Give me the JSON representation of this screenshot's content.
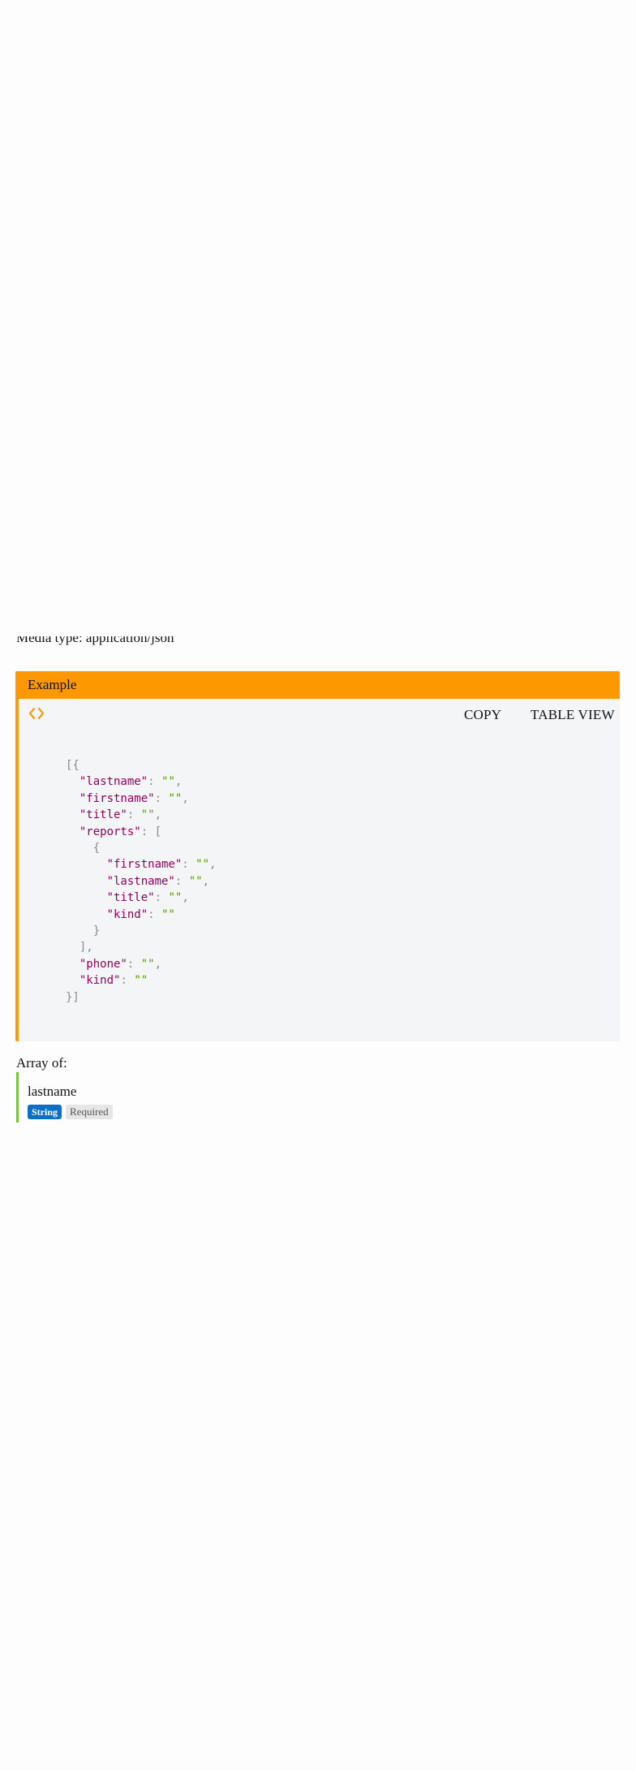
{
  "media_type": {
    "text": "Media type:  application/json"
  },
  "example": {
    "header": "Example",
    "toggle_icon": "code-brackets-icon",
    "copy_label": "COPY",
    "table_view_label": "TABLE VIEW",
    "accent_color": "#fd9801"
  },
  "schema": {
    "array_label": "Array of:",
    "property": {
      "name": "lastname",
      "type_badge": "String",
      "required_badge": "Required"
    },
    "type_color": "#0b6fc4",
    "property_border_color": "#7cc046"
  }
}
